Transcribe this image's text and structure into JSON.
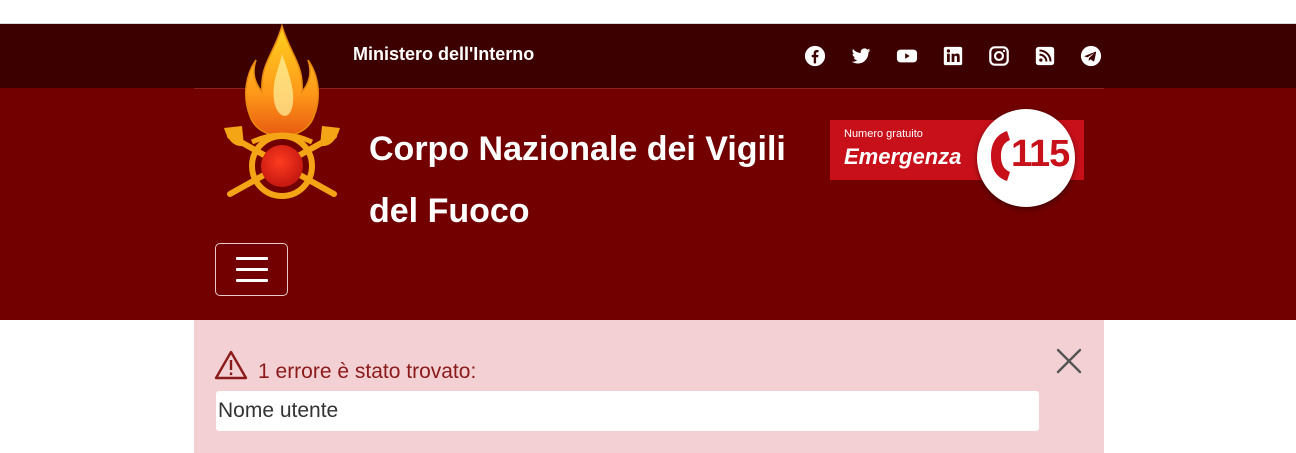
{
  "topbar": {
    "ministry": "Ministero dell'Interno",
    "social": [
      {
        "name": "facebook-icon"
      },
      {
        "name": "twitter-icon"
      },
      {
        "name": "youtube-icon"
      },
      {
        "name": "linkedin-icon"
      },
      {
        "name": "instagram-icon"
      },
      {
        "name": "rss-icon"
      },
      {
        "name": "telegram-icon"
      }
    ]
  },
  "header": {
    "brand_line1": "Corpo Nazionale dei Vigili",
    "brand_line2": "del Fuoco",
    "emergency_small": "Numero gratuito",
    "emergency_big": "Emergenza",
    "emergency_number": "115"
  },
  "alert": {
    "title": "1 errore è stato trovato:",
    "item": "Nome utente"
  },
  "colors": {
    "topbar_bg": "#3d0000",
    "header_bg": "#720000",
    "emergency_red": "#c8101a",
    "alert_bg": "#f3d0d3",
    "alert_text": "#8b1a1a"
  }
}
